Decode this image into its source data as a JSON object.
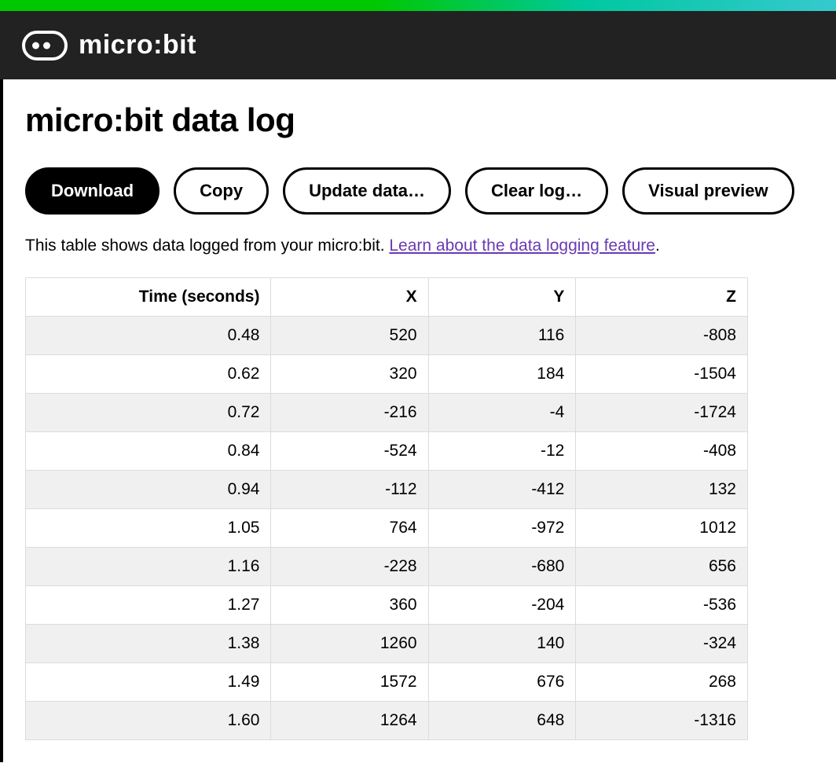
{
  "header": {
    "brand": "micro:bit"
  },
  "page": {
    "title": "micro:bit data log",
    "intro_text": "This table shows data logged from your micro:bit. ",
    "link_text": "Learn about the data logging feature",
    "period": "."
  },
  "buttons": {
    "download": "Download",
    "copy": "Copy",
    "update": "Update data…",
    "clear": "Clear log…",
    "preview": "Visual preview"
  },
  "table": {
    "headers": [
      "Time (seconds)",
      "X",
      "Y",
      "Z"
    ],
    "rows": [
      [
        "0.48",
        "520",
        "116",
        "-808"
      ],
      [
        "0.62",
        "320",
        "184",
        "-1504"
      ],
      [
        "0.72",
        "-216",
        "-4",
        "-1724"
      ],
      [
        "0.84",
        "-524",
        "-12",
        "-408"
      ],
      [
        "0.94",
        "-112",
        "-412",
        "132"
      ],
      [
        "1.05",
        "764",
        "-972",
        "1012"
      ],
      [
        "1.16",
        "-228",
        "-680",
        "656"
      ],
      [
        "1.27",
        "360",
        "-204",
        "-536"
      ],
      [
        "1.38",
        "1260",
        "140",
        "-324"
      ],
      [
        "1.49",
        "1572",
        "676",
        "268"
      ],
      [
        "1.60",
        "1264",
        "648",
        "-1316"
      ]
    ]
  }
}
